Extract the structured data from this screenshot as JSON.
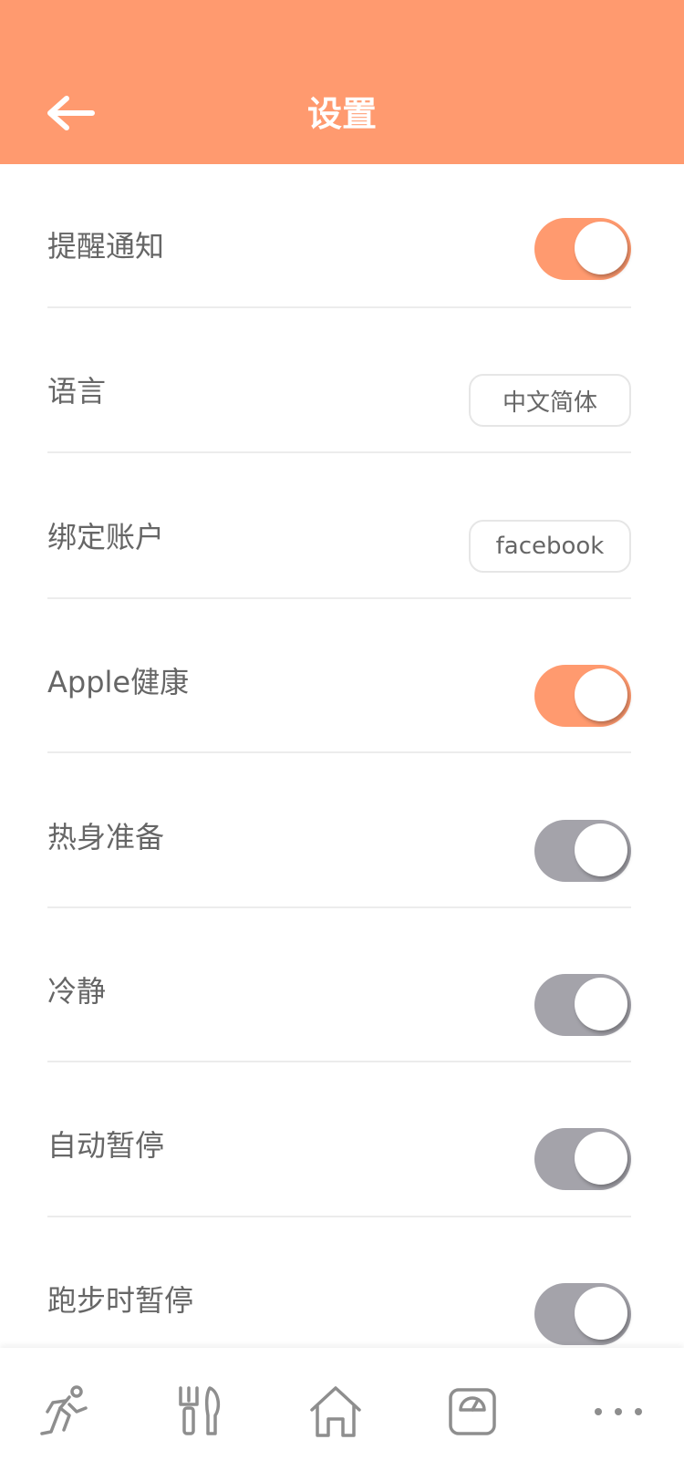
{
  "header": {
    "title": "设置",
    "back_icon": "arrow-left-icon",
    "background": "#FF9A6F"
  },
  "colors": {
    "accent": "#FF9A6F",
    "toggle_on": "#FF9A6F",
    "toggle_off": "#A4A3AA",
    "text": "#666666",
    "divider": "#ECECEC"
  },
  "settings": [
    {
      "label": "提醒通知",
      "control": "toggle",
      "on": true
    },
    {
      "label": "语言",
      "control": "select",
      "value": "中文简体"
    },
    {
      "label": "绑定账户",
      "control": "select",
      "value": "facebook"
    },
    {
      "label": "Apple健康",
      "control": "toggle",
      "on": true
    },
    {
      "label": "热身准备",
      "control": "toggle",
      "on": false
    },
    {
      "label": "冷静",
      "control": "toggle",
      "on": false
    },
    {
      "label": "自动暂停",
      "control": "toggle",
      "on": false
    },
    {
      "label": "跑步时暂停",
      "control": "toggle",
      "on": false
    }
  ],
  "tabbar": {
    "items": [
      {
        "icon": "running-icon"
      },
      {
        "icon": "fork-knife-icon"
      },
      {
        "icon": "home-icon"
      },
      {
        "icon": "scale-icon"
      },
      {
        "icon": "more-icon"
      }
    ]
  }
}
